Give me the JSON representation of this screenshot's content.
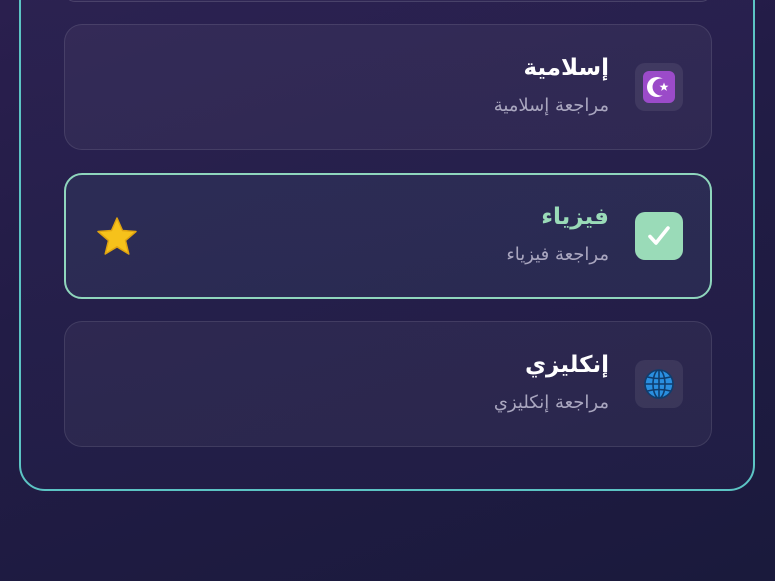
{
  "subjects": [
    {
      "title": "إسلامية",
      "subtitle": "مراجعة إسلامية",
      "icon": "star-and-crescent-icon",
      "selected": false
    },
    {
      "title": "فيزياء",
      "subtitle": "مراجعة فيزياء",
      "icon": "check-mark-icon",
      "selected": true,
      "badge": "star-icon"
    },
    {
      "title": "إنكليزي",
      "subtitle": "مراجعة إنكليزي",
      "icon": "globe-icon",
      "selected": false
    }
  ],
  "colors": {
    "panel_border": "#5cc4c4",
    "selected_accent": "#9adbb8",
    "crescent_bg": "#9b4bc9",
    "globe": "#2a8fe0",
    "star": "#f6c21b"
  }
}
